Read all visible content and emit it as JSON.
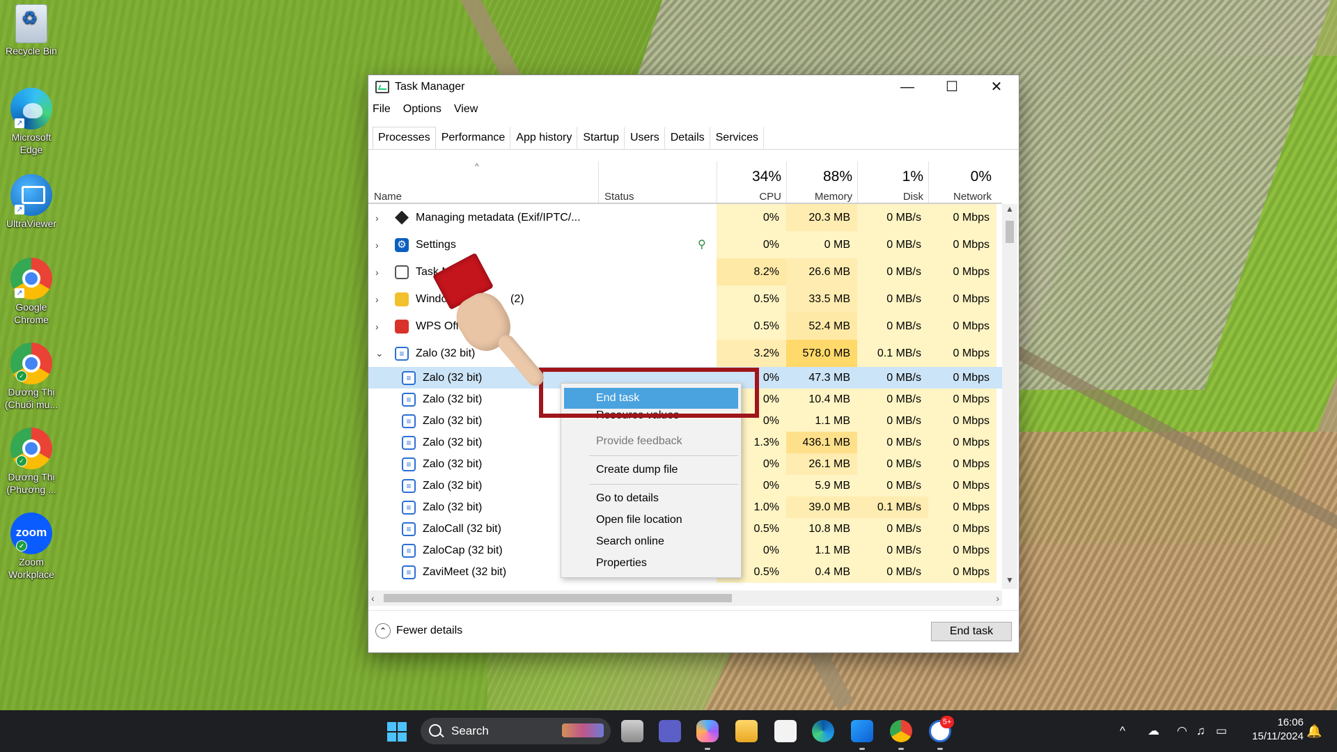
{
  "desktop": {
    "icons": [
      {
        "label": "Recycle Bin",
        "icon": "recycle-bin-icon"
      },
      {
        "label": "Microsoft Edge",
        "icon": "edge-icon"
      },
      {
        "label": "UltraViewer",
        "icon": "ultraviewer-icon"
      },
      {
        "label": "Google Chrome",
        "icon": "chrome-icon"
      },
      {
        "label": "Dương Thị (Chuối mu...",
        "icon": "chrome-profile-icon"
      },
      {
        "label": "Dương Thị (Phương ...",
        "icon": "chrome-profile-icon"
      },
      {
        "label": "Zoom Workplace",
        "icon": "zoom-icon",
        "logo_text": "zoom"
      }
    ]
  },
  "window": {
    "title": "Task Manager",
    "controls": {
      "minimize": "—",
      "maximize": "☐",
      "close": "✕"
    },
    "menu": [
      "File",
      "Options",
      "View"
    ],
    "tabs": [
      "Processes",
      "Performance",
      "App history",
      "Startup",
      "Users",
      "Details",
      "Services"
    ],
    "active_tab": "Processes"
  },
  "columns": {
    "name": "Name",
    "status": "Status",
    "cpu": {
      "pct": "34%",
      "label": "CPU"
    },
    "memory": {
      "pct": "88%",
      "label": "Memory"
    },
    "disk": {
      "pct": "1%",
      "label": "Disk"
    },
    "network": {
      "pct": "0%",
      "label": "Network"
    }
  },
  "processes": [
    {
      "name": "Managing metadata (Exif/IPTC/...",
      "icon": "metadata-icon",
      "cpu": "0%",
      "mem": "20.3 MB",
      "disk": "0 MB/s",
      "net": "0 Mbps",
      "expand": "›"
    },
    {
      "name": "Settings",
      "icon": "settings-icon",
      "cpu": "0%",
      "mem": "0 MB",
      "disk": "0 MB/s",
      "net": "0 Mbps",
      "expand": "›",
      "status_icon": "leaf-icon"
    },
    {
      "name": "Task M",
      "icon": "task-manager-icon",
      "cpu": "8.2%",
      "mem": "26.6 MB",
      "disk": "0 MB/s",
      "net": "0 Mbps",
      "expand": "›"
    },
    {
      "name": "Windo",
      "suffix": "(2)",
      "icon": "windows-explorer-icon",
      "cpu": "0.5%",
      "mem": "33.5 MB",
      "disk": "0 MB/s",
      "net": "0 Mbps",
      "expand": "›"
    },
    {
      "name": "WPS Offic",
      "icon": "wps-icon",
      "cpu": "0.5%",
      "mem": "52.4 MB",
      "disk": "0 MB/s",
      "net": "0 Mbps",
      "expand": "›"
    },
    {
      "name": "Zalo (32 bit)",
      "icon": "zalo-icon",
      "cpu": "3.2%",
      "mem": "578.0 MB",
      "disk": "0.1 MB/s",
      "net": "0 Mbps",
      "expand": "⌄"
    }
  ],
  "children": [
    {
      "name": "Zalo (32 bit)",
      "cpu": "0%",
      "mem": "47.3 MB",
      "disk": "0 MB/s",
      "net": "0 Mbps",
      "selected": true
    },
    {
      "name": "Zalo (32 bit)",
      "cpu": "0%",
      "mem": "10.4 MB",
      "disk": "0 MB/s",
      "net": "0 Mbps"
    },
    {
      "name": "Zalo (32 bit)",
      "cpu": "0%",
      "mem": "1.1 MB",
      "disk": "0 MB/s",
      "net": "0 Mbps"
    },
    {
      "name": "Zalo (32 bit)",
      "cpu": "1.3%",
      "mem": "436.1 MB",
      "disk": "0 MB/s",
      "net": "0 Mbps"
    },
    {
      "name": "Zalo (32 bit)",
      "cpu": "0%",
      "mem": "26.1 MB",
      "disk": "0 MB/s",
      "net": "0 Mbps"
    },
    {
      "name": "Zalo (32 bit)",
      "cpu": "0%",
      "mem": "5.9 MB",
      "disk": "0 MB/s",
      "net": "0 Mbps"
    },
    {
      "name": "Zalo (32 bit)",
      "cpu": "1.0%",
      "mem": "39.0 MB",
      "disk": "0.1 MB/s",
      "net": "0 Mbps"
    },
    {
      "name": "ZaloCall (32 bit)",
      "cpu": "0.5%",
      "mem": "10.8 MB",
      "disk": "0 MB/s",
      "net": "0 Mbps"
    },
    {
      "name": "ZaloCap (32 bit)",
      "cpu": "0%",
      "mem": "1.1 MB",
      "disk": "0 MB/s",
      "net": "0 Mbps"
    },
    {
      "name": "ZaviMeet (32 bit)",
      "cpu": "0.5%",
      "mem": "0.4 MB",
      "disk": "0 MB/s",
      "net": "0 Mbps"
    }
  ],
  "context_menu": {
    "items": [
      "End task",
      "Resource values",
      "Provide feedback",
      "Create dump file",
      "Go to details",
      "Open file location",
      "Search online",
      "Properties"
    ]
  },
  "footer": {
    "fewer_details": "Fewer details",
    "end_task": "End task"
  },
  "taskbar": {
    "search_placeholder": "Search",
    "pinned": [
      "file-icon",
      "teams-icon",
      "copilot-icon",
      "explorer-icon",
      "store-icon",
      "edge-icon",
      "snipping-icon",
      "chrome-icon",
      "zalo-icon"
    ],
    "zalo_badge": "5+",
    "time": "16:06",
    "date": "15/11/2024"
  },
  "colors": {
    "cpu_heat": "#fff4c4",
    "mem_heat": "#ffe48a",
    "selected_row": "#cce4f7",
    "menu_highlight": "#4aa3df",
    "highlight_box": "#a0151b",
    "taskbar": "#1e1f22"
  }
}
